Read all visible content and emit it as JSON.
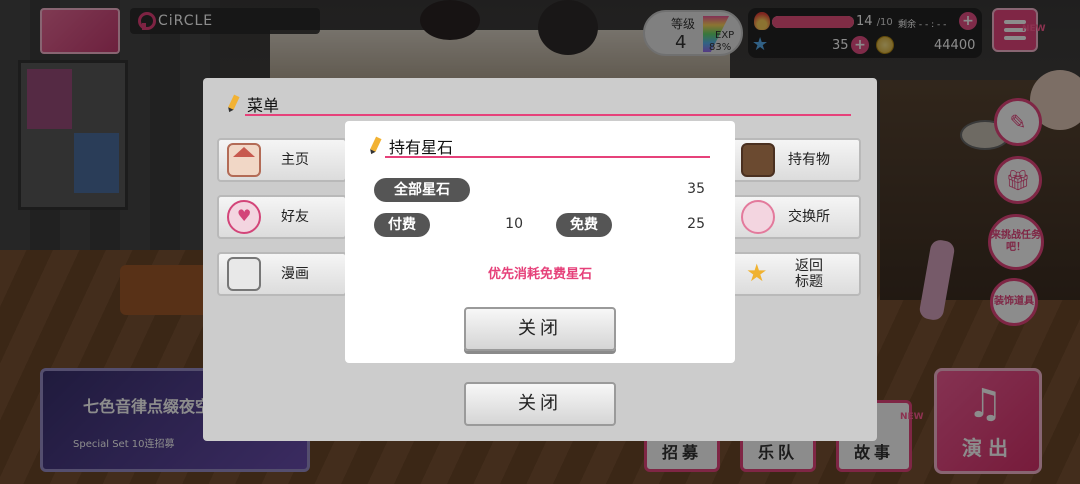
{
  "hud": {
    "location": "CiRCLE",
    "level_label": "等级",
    "level_value": "4",
    "exp_label": "EXP",
    "exp_percent": "83%",
    "stamina_current": "14",
    "stamina_max": "/10",
    "stamina_fill_ratio": 1.0,
    "recover_text": "剩余 - - : - -",
    "stars": "35",
    "coins": "44400",
    "menu_new_badge": "NEW",
    "side_new_badge": "NEW"
  },
  "side_buttons": [
    {
      "label": "来挑战任务吧！"
    },
    {
      "label": "装饰道具"
    }
  ],
  "bottom_bar": {
    "promo_title": "七色音律点缀夜空",
    "promo_sub": "Special Set 10连招募",
    "tabs": [
      "招募",
      "乐队",
      "故事"
    ],
    "live_label": "演出"
  },
  "menu": {
    "title": "菜单",
    "left_items": [
      {
        "label": "主页",
        "icon": "home-icon"
      },
      {
        "label": "好友",
        "icon": "friend-heart-icon"
      },
      {
        "label": "漫画",
        "icon": "manga-icon"
      }
    ],
    "right_items": [
      {
        "label": "持有物",
        "icon": "bag-icon"
      },
      {
        "label": "交换所",
        "icon": "exchange-icon"
      },
      {
        "label": "返回\n标题",
        "icon": "star-return-icon"
      }
    ],
    "close_label": "关闭"
  },
  "dialog": {
    "title": "持有星石",
    "total_label": "全部星石",
    "total_value": "35",
    "paid_label": "付费",
    "paid_value": "10",
    "free_label": "免费",
    "free_value": "25",
    "notice": "优先消耗免费星石",
    "close_label": "关闭"
  },
  "colors": {
    "accent": "#e6417a",
    "pill": "#555555",
    "panel": "#cccccc"
  }
}
